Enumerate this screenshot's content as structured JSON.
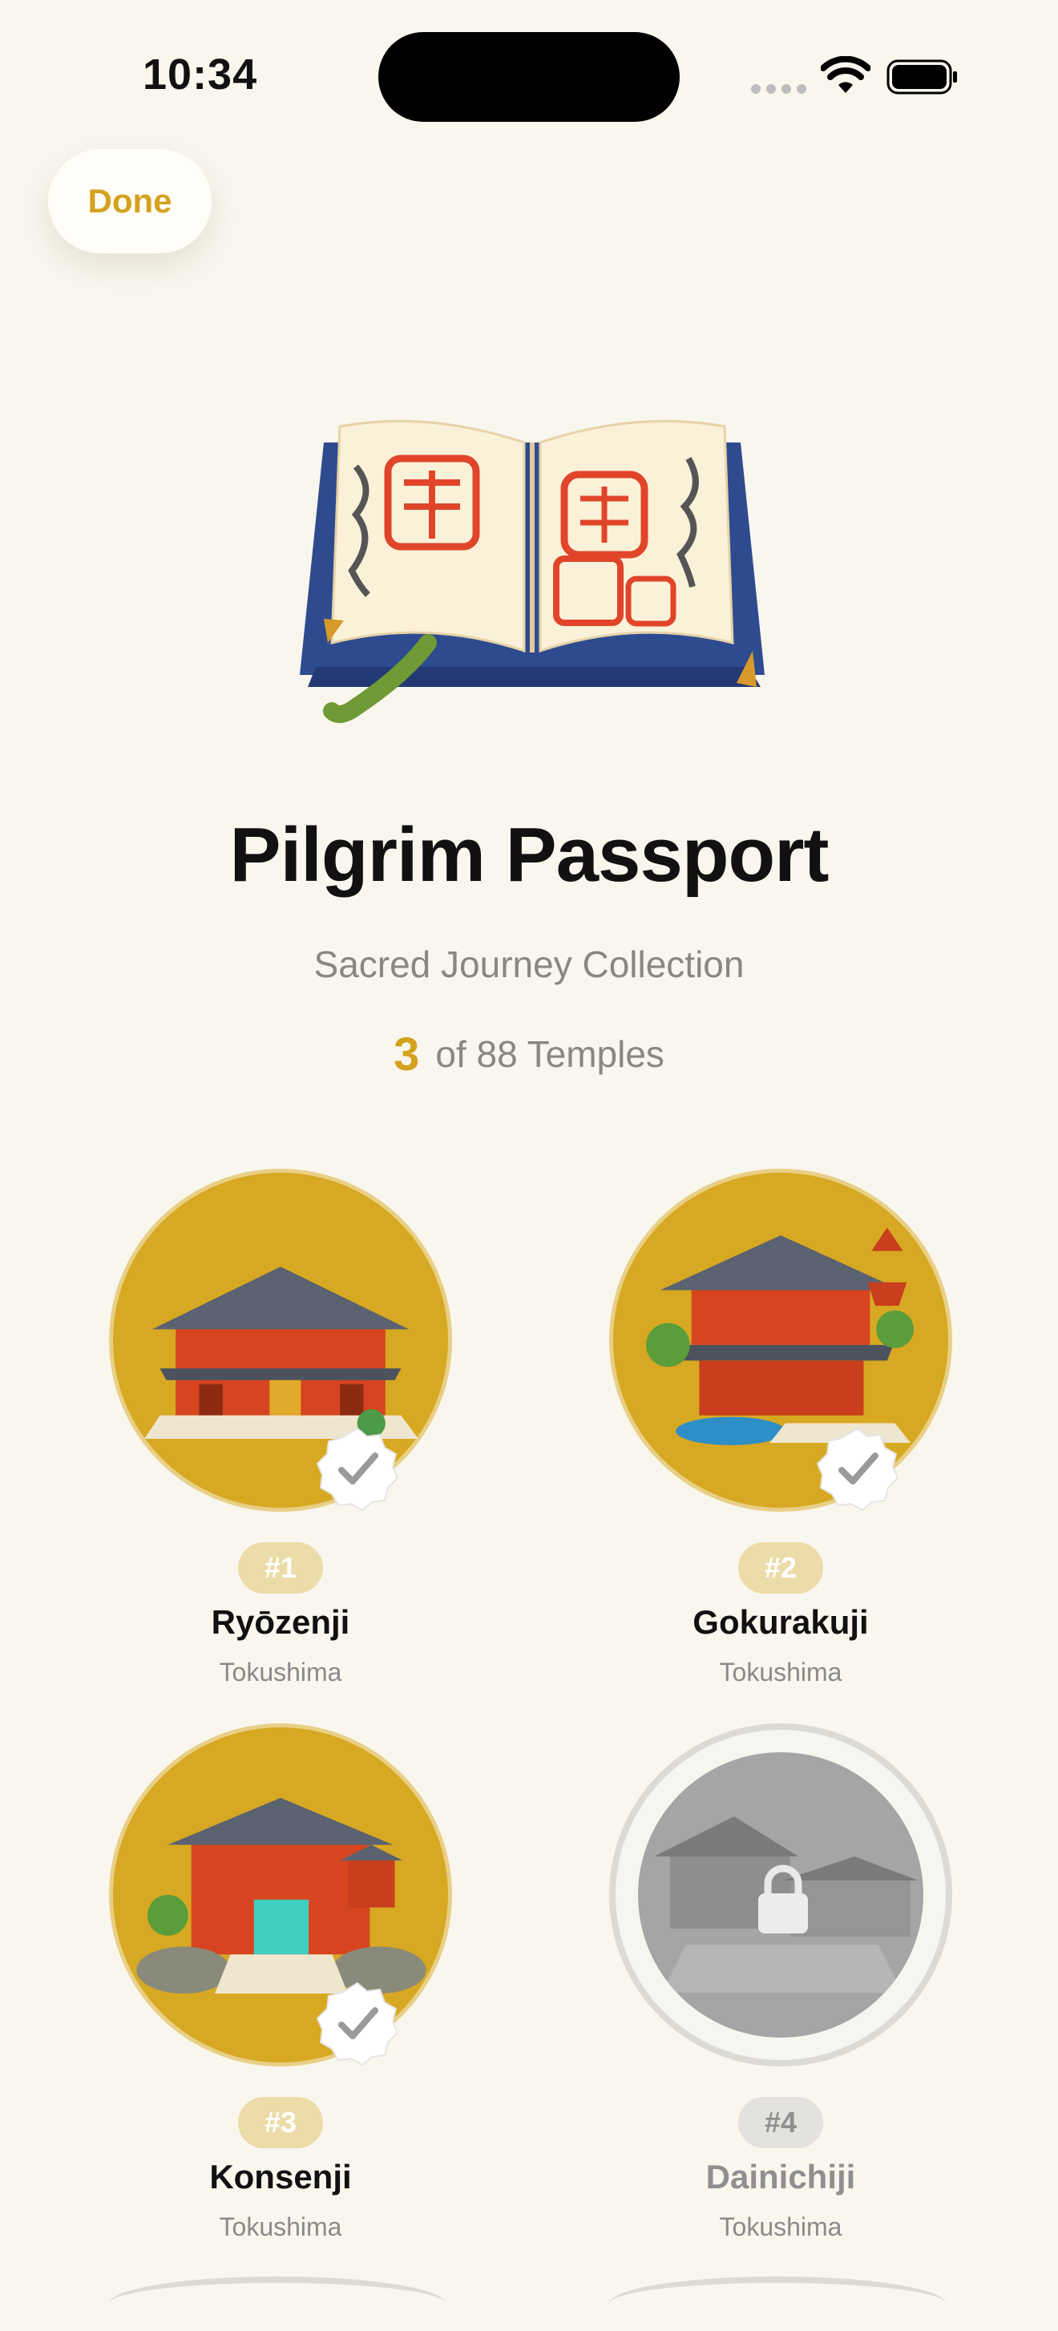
{
  "status_bar": {
    "time": "10:34"
  },
  "nav": {
    "done_label": "Done"
  },
  "header": {
    "title": "Pilgrim Passport",
    "subtitle": "Sacred Journey Collection",
    "collected_count": "3",
    "progress_suffix": "of 88 Temples"
  },
  "colors": {
    "accent": "#d4a21f",
    "background": "#f9f6ee",
    "medal_gold": "#d7a822",
    "locked_gray": "#a5a5a5"
  },
  "temples": [
    {
      "number": "#1",
      "name": "Ryōzenji",
      "region": "Tokushima",
      "status": "visited"
    },
    {
      "number": "#2",
      "name": "Gokurakuji",
      "region": "Tokushima",
      "status": "visited"
    },
    {
      "number": "#3",
      "name": "Konsenji",
      "region": "Tokushima",
      "status": "visited"
    },
    {
      "number": "#4",
      "name": "Dainichiji",
      "region": "Tokushima",
      "status": "locked"
    }
  ],
  "icons": [
    "wifi-icon",
    "battery-icon",
    "passport-book-icon",
    "checkmark-badge-icon",
    "lock-icon"
  ]
}
